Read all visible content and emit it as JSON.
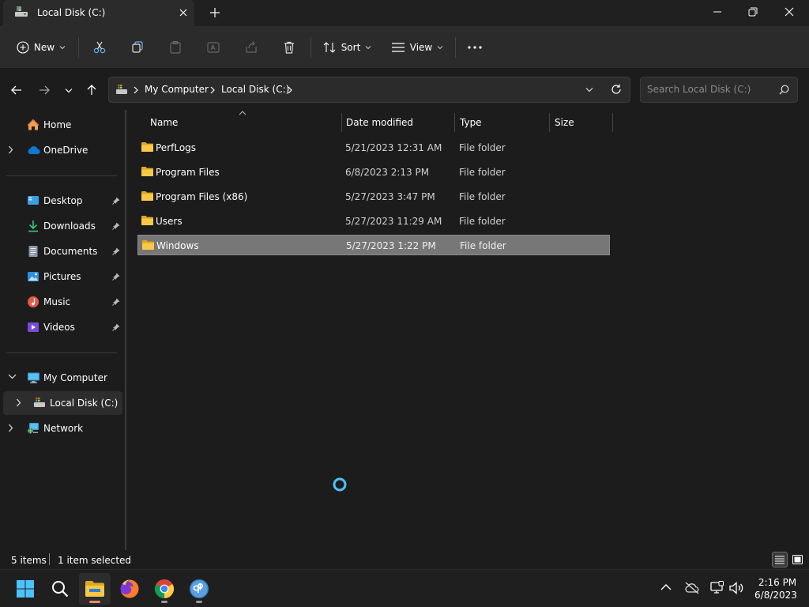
{
  "window": {
    "tab_title": "Local Disk (C:)"
  },
  "toolbar": {
    "new_label": "New",
    "sort_label": "Sort",
    "view_label": "View"
  },
  "address": {
    "crumbs": [
      "My Computer",
      "Local Disk (C:)"
    ]
  },
  "search": {
    "placeholder": "Search Local Disk (C:)"
  },
  "sidebar": {
    "home": "Home",
    "onedrive": "OneDrive",
    "desktop": "Desktop",
    "downloads": "Downloads",
    "documents": "Documents",
    "pictures": "Pictures",
    "music": "Music",
    "videos": "Videos",
    "my_computer": "My Computer",
    "local_disk": "Local Disk (C:)",
    "network": "Network"
  },
  "columns": {
    "name": "Name",
    "date": "Date modified",
    "type": "Type",
    "size": "Size"
  },
  "files": [
    {
      "name": "PerfLogs",
      "date": "5/21/2023 12:31 AM",
      "type": "File folder"
    },
    {
      "name": "Program Files",
      "date": "6/8/2023 2:13 PM",
      "type": "File folder"
    },
    {
      "name": "Program Files (x86)",
      "date": "5/27/2023 3:47 PM",
      "type": "File folder"
    },
    {
      "name": "Users",
      "date": "5/27/2023 11:29 AM",
      "type": "File folder"
    },
    {
      "name": "Windows",
      "date": "5/27/2023 1:22 PM",
      "type": "File folder"
    }
  ],
  "status": {
    "items": "5 items",
    "selected": "1 item selected"
  },
  "taskbar": {
    "time": "2:16 PM",
    "date": "6/8/2023"
  },
  "colors": {
    "accent": "#4cc2ff",
    "folder": "#f5c242",
    "selection": "#777777"
  }
}
